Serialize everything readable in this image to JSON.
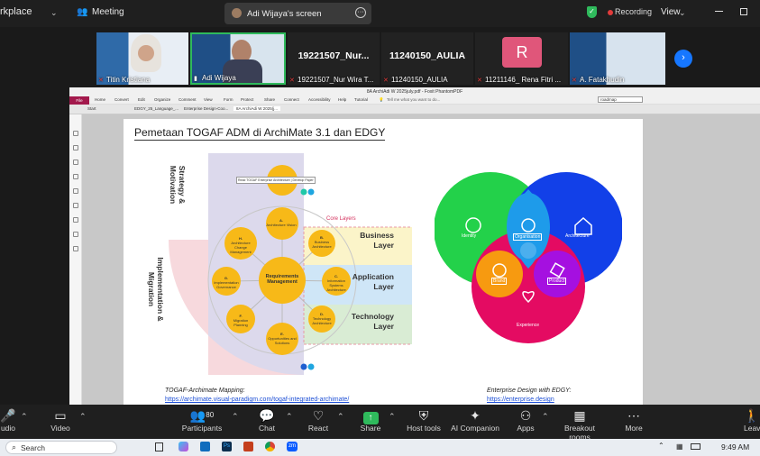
{
  "topbar": {
    "app_name": "rkplace",
    "meeting_label": "Meeting",
    "screen_label": "Adi Wijaya's screen",
    "recording_label": "Recording",
    "view_label": "View"
  },
  "participants": [
    {
      "name": "Titin Kristiana"
    },
    {
      "name": "Adi Wijaya"
    },
    {
      "name": "19221507_Nur Wira T...",
      "display": "19221507_Nur..."
    },
    {
      "name": "11240150_AULIA",
      "display": "11240150_AULIA"
    },
    {
      "name": "11211146_ Rena Fitri ...",
      "display": "R"
    },
    {
      "name": "A. Fatakhudin"
    }
  ],
  "pdf": {
    "window_title": "8A ArchiAdi W 2025july.pdf - Foxit PhantomPDF",
    "file_label": "File",
    "ribbon": [
      "Home",
      "Convert",
      "Edit",
      "Organize",
      "Comment",
      "View",
      "Form",
      "Protect",
      "Share",
      "Connect",
      "Accessibility",
      "Help",
      "Tutorial"
    ],
    "tell_me": "Tell me what you want to do...",
    "search_value": "roadmap",
    "tabs": [
      "Start",
      "EDGY_25_Language_...",
      "Enterprise Design-Coo...",
      "8A ArchiAdi W 2025(j..."
    ]
  },
  "slide": {
    "title": "Pemetaan TOGAF ADM di ArchiMate 3.1 dan EDGY",
    "strategy_label": "Strategy & Motivation",
    "implementation_label": "Implementation & Migration",
    "core_layers": "Core Layers",
    "tooltip": "Read TOGAF Enterprise Architecture | Develop Paper",
    "phases": [
      {
        "id": "A.",
        "text": "Architecture Vision"
      },
      {
        "id": "B.",
        "text": "Business Architecture"
      },
      {
        "id": "C.",
        "text": "Information Systems Architecture"
      },
      {
        "id": "D.",
        "text": "Technology Architecture"
      },
      {
        "id": "E.",
        "text": "Opportunities and Solutions"
      },
      {
        "id": "F.",
        "text": "Migration Planning"
      },
      {
        "id": "G.",
        "text": "Implementation Governance"
      },
      {
        "id": "H.",
        "text": "Architecture Change Management"
      },
      {
        "id": "",
        "text": "Requirements Management"
      }
    ],
    "layers": [
      "Business Layer",
      "Application Layer",
      "Technology Layer"
    ],
    "venn": {
      "identity": "Identity",
      "architecture": "Architecture",
      "experience": "Experience",
      "organisation": "Organisation",
      "brand": "Brand",
      "product": "Product"
    },
    "left_caption": "TOGAF-Archimate Mapping:",
    "left_link": "https://archimate.visual-paradigm.com/togaf-integrated-archimate/",
    "right_caption": "Enterprise Design with EDGY:",
    "right_link": "https://enterprise.design"
  },
  "toolbar": {
    "audio": "udio",
    "video": "Video",
    "participants": "Participants",
    "participants_count": "80",
    "chat": "Chat",
    "react": "React",
    "share": "Share",
    "host_tools": "Host tools",
    "ai_companion": "AI Companion",
    "apps": "Apps",
    "breakout": "Breakout rooms",
    "more": "More",
    "leave": "Leav"
  },
  "taskbar": {
    "search": "Search",
    "time": "9:49 AM"
  },
  "colors": {
    "recording": "#e23b3b",
    "share_green": "#2fba5c",
    "accent_blue": "#1677ff",
    "file_tab": "#a3194c"
  }
}
